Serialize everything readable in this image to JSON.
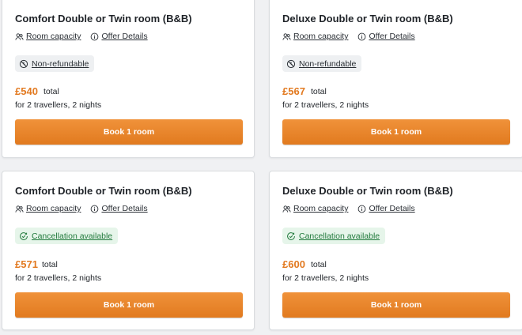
{
  "offers": [
    {
      "title": "Comfort Double or Twin room (B&B)",
      "room_capacity_link": "Room capacity",
      "offer_details_link": "Offer Details",
      "policy": "Non-refundable",
      "policy_type": "non-refundable",
      "price": "£540",
      "price_suffix": "total",
      "travellers": "for 2 travellers, 2 nights",
      "book_label": "Book 1 room"
    },
    {
      "title": "Deluxe Double or Twin room (B&B)",
      "room_capacity_link": "Room capacity",
      "offer_details_link": "Offer Details",
      "policy": "Non-refundable",
      "policy_type": "non-refundable",
      "price": "£567",
      "price_suffix": "total",
      "travellers": "for 2 travellers, 2 nights",
      "book_label": "Book 1 room"
    },
    {
      "title": "Comfort Double or Twin room (B&B)",
      "room_capacity_link": "Room capacity",
      "offer_details_link": "Offer Details",
      "policy": "Cancellation available",
      "policy_type": "cancellation",
      "price": "£571",
      "price_suffix": "total",
      "travellers": "for 2 travellers, 2 nights",
      "book_label": "Book 1 room"
    },
    {
      "title": "Deluxe Double or Twin room (B&B)",
      "room_capacity_link": "Room capacity",
      "offer_details_link": "Offer Details",
      "policy": "Cancellation available",
      "policy_type": "cancellation",
      "price": "£600",
      "price_suffix": "total",
      "travellers": "for 2 travellers, 2 nights",
      "book_label": "Book 1 room"
    }
  ],
  "colors": {
    "accent_orange": "#e27a21",
    "cancellation_green": "#217a3c",
    "cancellation_bg": "#e6f5ea",
    "nonrefundable_bg": "#eef0f2"
  },
  "icons": {
    "room_capacity": "people-icon",
    "offer_details": "info-icon",
    "non_refundable": "no-refund-clock-icon",
    "cancellation": "check-circle-icon"
  }
}
